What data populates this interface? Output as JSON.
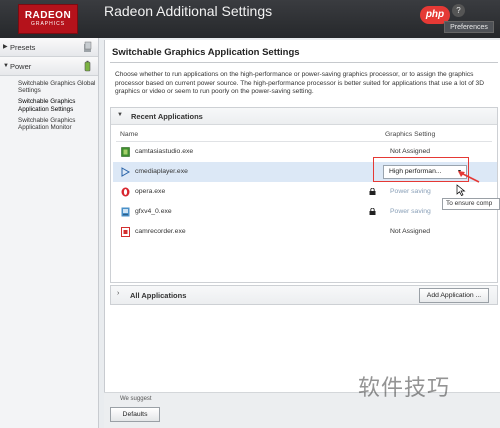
{
  "window": {
    "logo_line1": "RADEON",
    "logo_line2": "GRAPHICS",
    "title": "Radeon Additional Settings",
    "help_label": "?",
    "preferences_label": "Preferences",
    "watermark_php": "php"
  },
  "sidebar": {
    "presets_label": "Presets",
    "power_label": "Power",
    "items": [
      {
        "label": "Switchable Graphics Global Settings"
      },
      {
        "label": "Switchable Graphics Application Settings"
      },
      {
        "label": "Switchable Graphics Application Monitor"
      }
    ]
  },
  "main": {
    "page_title": "Switchable Graphics Application Settings",
    "description": "Choose whether to run applications on the high-performance or power-saving graphics processor, or to assign the graphics processor based on current power source. The high-performance processor is better suited for applications that use a lot of 3D graphics or video or seem to run poorly on the power-saving setting.",
    "recent_panel": {
      "label": "Recent Applications",
      "col_name": "Name",
      "col_setting": "Graphics Setting",
      "rows": [
        {
          "name": "camtasiastudio.exe",
          "setting": "Not Assigned",
          "locked": false,
          "icon": "camtasia-icon"
        },
        {
          "name": "cmediaplayer.exe",
          "setting": "High performan...",
          "locked": false,
          "icon": "media-player-icon",
          "selected": true
        },
        {
          "name": "opera.exe",
          "setting": "Power saving",
          "locked": true,
          "icon": "opera-icon"
        },
        {
          "name": "gfxv4_0.exe",
          "setting": "Power saving",
          "locked": true,
          "icon": "gfx-icon"
        },
        {
          "name": "camrecorder.exe",
          "setting": "Not Assigned",
          "locked": false,
          "icon": "camrecorder-icon"
        }
      ]
    },
    "all_panel": {
      "label": "All Applications",
      "add_button": "Add Application ..."
    },
    "tooltip": "To ensure comp"
  },
  "footer": {
    "note": "We suggest",
    "defaults_button": "Defaults"
  },
  "watermark_cn": "软件技巧",
  "colors": {
    "titlebar": "#2c2e31",
    "logo_red": "#b5121b",
    "highlight_red": "#e53935",
    "selected_row": "#dce8f6"
  }
}
